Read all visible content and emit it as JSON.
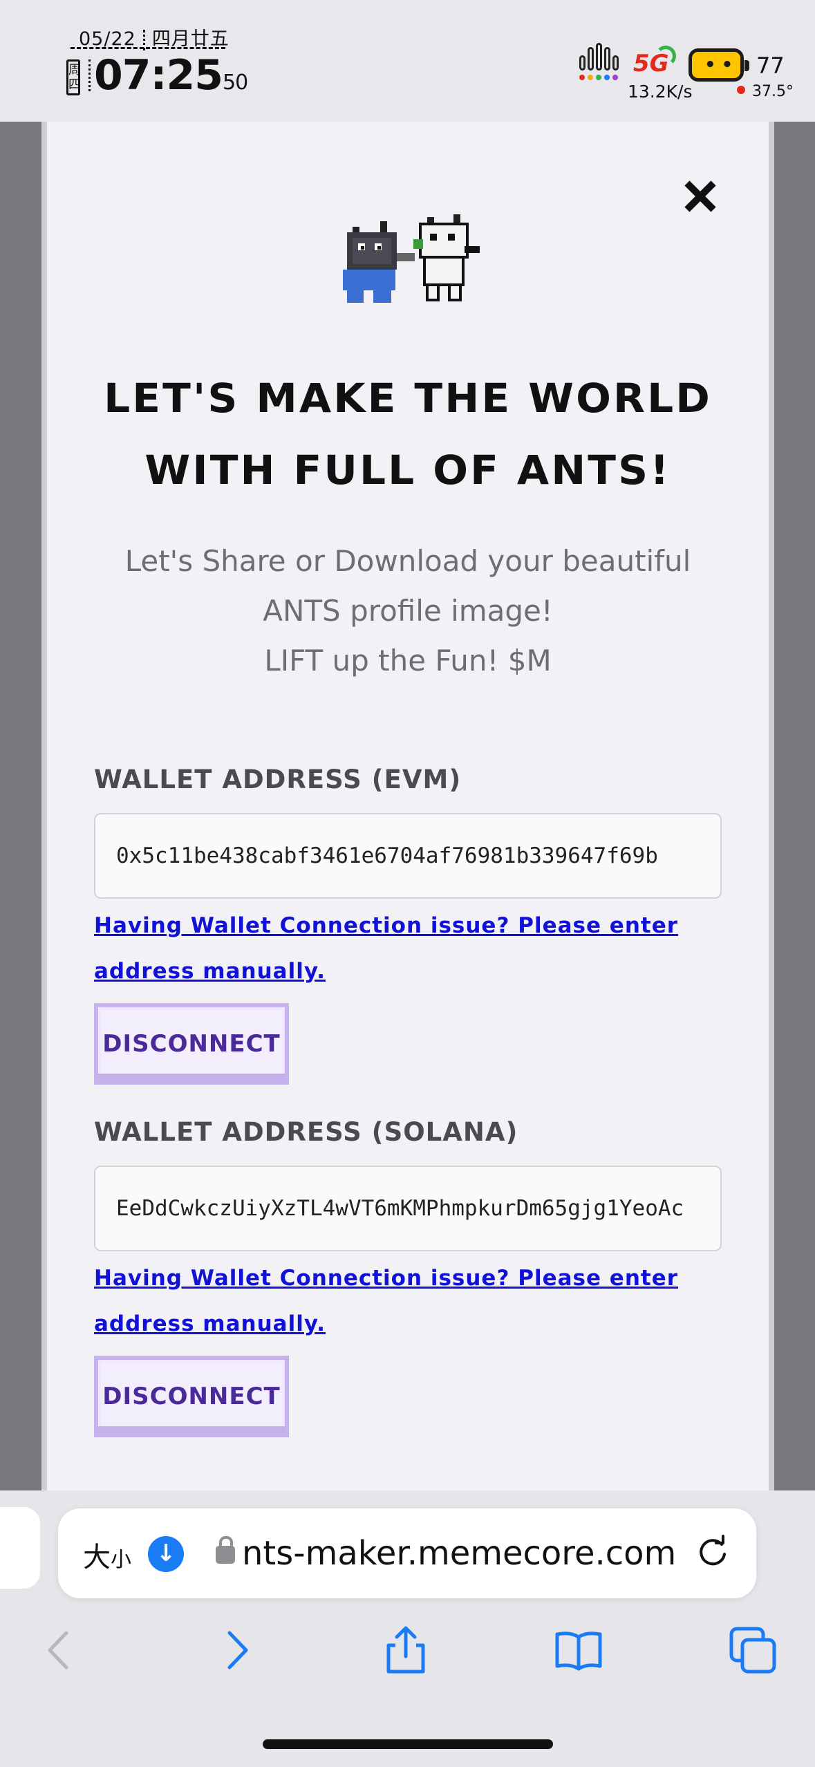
{
  "status_bar": {
    "date": "05/22",
    "lunar_date": "四月廿五",
    "weekday": "周四",
    "time": "07:25",
    "seconds": "50",
    "network": "5G",
    "speed": "13.2K/s",
    "battery": "77",
    "temperature": "37.5°"
  },
  "modal": {
    "headline_line1": "LET'S MAKE THE WORLD",
    "headline_line2": "WITH FULL OF ANTS!",
    "sub_line1": "Let's Share or Download your beautiful",
    "sub_line2": "ANTS profile image!",
    "sub_line3": "LIFT up the Fun! $M",
    "evm": {
      "label": "WALLET ADDRESS (EVM)",
      "value": "0x5c11be438cabf3461e6704af76981b339647f69b",
      "help": "Having Wallet Connection issue? Please enter address manually.",
      "button": "Disconnect"
    },
    "solana": {
      "label": "WALLET ADDRESS (SOLANA)",
      "value": "EeDdCwkczUiyXzTL4wVT6mKMPhmpkurDm65gjg1YeoAc",
      "help": "Having Wallet Connection issue? Please enter address manually.",
      "button": "Disconnect"
    }
  },
  "browser": {
    "text_size": "大",
    "text_size_small": "小",
    "url": "nts-maker.memecore.com"
  },
  "colors": {
    "link": "#1212d6",
    "button_text": "#4a2a98",
    "button_border": "#c7b2ee",
    "accent_blue": "#1a7cf5"
  }
}
